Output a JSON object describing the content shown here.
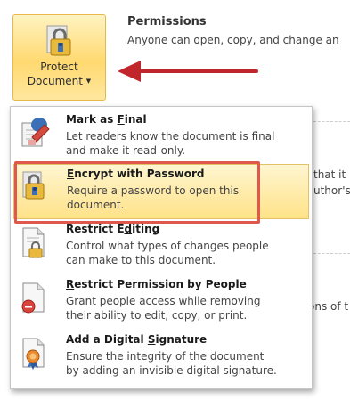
{
  "protect_button": {
    "line1": "Protect",
    "line2": "Document"
  },
  "permissions": {
    "title": "Permissions",
    "description": "Anyone can open, copy, and change an"
  },
  "background": {
    "partial_1": "that it",
    "partial_2": "uthor's",
    "partial_3": "ons of t"
  },
  "menu": {
    "items": [
      {
        "title_pre": "Mark as ",
        "title_key": "F",
        "title_post": "inal",
        "line1": "Let readers know the document is final",
        "line2": "and make it read-only.",
        "icon": "mark-final-icon"
      },
      {
        "title_pre": "",
        "title_key": "E",
        "title_post": "ncrypt with Password",
        "line1": "Require a password to open this",
        "line2": "document.",
        "icon": "encrypt-lock-icon"
      },
      {
        "title_pre": "Restrict E",
        "title_key": "d",
        "title_post": "iting",
        "line1": "Control what types of changes people",
        "line2": "can make to this document.",
        "icon": "restrict-editing-icon"
      },
      {
        "title_pre": "",
        "title_key": "R",
        "title_post": "estrict Permission by People",
        "line1": "Grant people access while removing",
        "line2": "their ability to edit, copy, or print.",
        "icon": "restrict-permission-icon"
      },
      {
        "title_pre": "Add a Digital ",
        "title_key": "S",
        "title_post": "ignature",
        "line1": "Ensure the integrity of the document",
        "line2": "by adding an invisible digital signature.",
        "icon": "digital-signature-icon"
      }
    ]
  },
  "colors": {
    "highlight_border": "#e0584b",
    "arrow": "#c0272d",
    "button_gold": "#ffd970"
  }
}
